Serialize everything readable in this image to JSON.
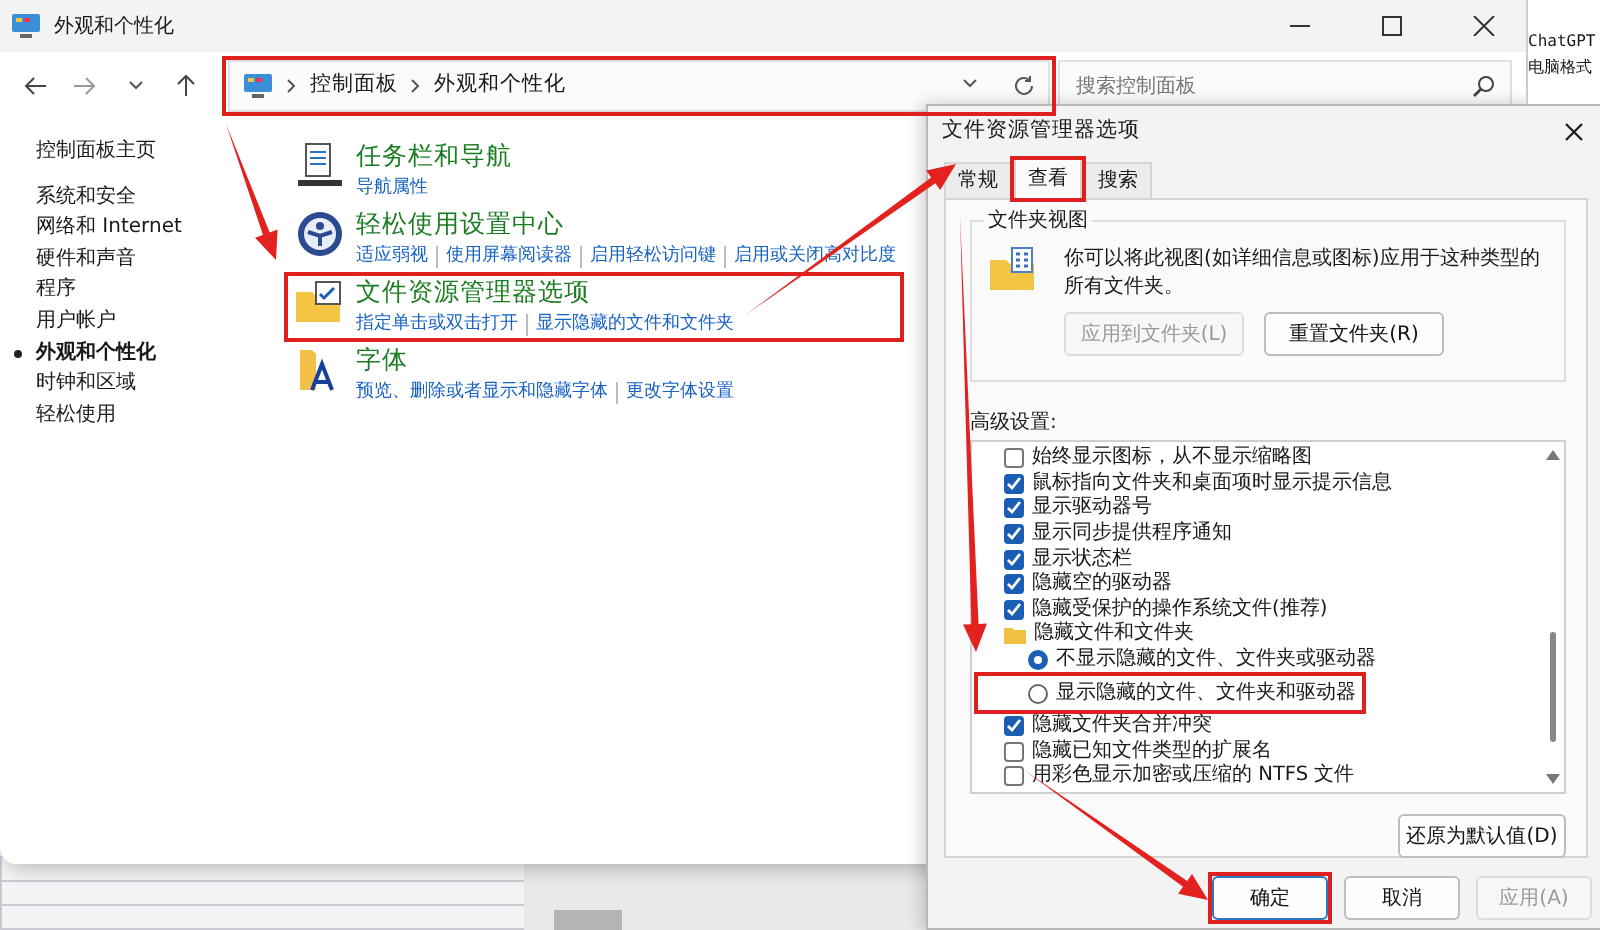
{
  "background_window": {
    "lines": [
      "ChatGPT",
      "电脑格式"
    ]
  },
  "main_window": {
    "title": "外观和个性化",
    "breadcrumb": [
      "控制面板",
      "外观和个性化"
    ],
    "search": {
      "placeholder": "搜索控制面板"
    },
    "sidebar": {
      "items": [
        {
          "label": "控制面板主页",
          "selected": false
        },
        {
          "label": "系统和安全",
          "selected": false
        },
        {
          "label": "网络和 Internet",
          "selected": false
        },
        {
          "label": "硬件和声音",
          "selected": false
        },
        {
          "label": "程序",
          "selected": false
        },
        {
          "label": "用户帐户",
          "selected": false
        },
        {
          "label": "外观和个性化",
          "selected": true
        },
        {
          "label": "时钟和区域",
          "selected": false
        },
        {
          "label": "轻松使用",
          "selected": false
        }
      ]
    },
    "categories": [
      {
        "title": "任务栏和导航",
        "links": [
          "导航属性"
        ]
      },
      {
        "title": "轻松使用设置中心",
        "links": [
          "适应弱视",
          "使用屏幕阅读器",
          "启用轻松访问键",
          "启用或关闭高对比度"
        ]
      },
      {
        "title": "文件资源管理器选项",
        "links": [
          "指定单击或双击打开",
          "显示隐藏的文件和文件夹"
        ]
      },
      {
        "title": "字体",
        "links": [
          "预览、删除或者显示和隐藏字体",
          "更改字体设置"
        ]
      }
    ]
  },
  "dialog": {
    "title": "文件资源管理器选项",
    "tabs": [
      {
        "label": "常规",
        "selected": false
      },
      {
        "label": "查看",
        "selected": true
      },
      {
        "label": "搜索",
        "selected": false
      }
    ],
    "group": {
      "title": "文件夹视图",
      "text": "你可以将此视图(如详细信息或图标)应用于这种类型的所有文件夹。",
      "buttons": [
        {
          "label": "应用到文件夹(L)",
          "disabled": true
        },
        {
          "label": "重置文件夹(R)",
          "disabled": false
        }
      ]
    },
    "advanced_label": "高级设置:",
    "settings": [
      {
        "kind": "checkbox",
        "label": "始终显示图标，从不显示缩略图",
        "checked": false
      },
      {
        "kind": "checkbox",
        "label": "鼠标指向文件夹和桌面项时显示提示信息",
        "checked": true
      },
      {
        "kind": "checkbox",
        "label": "显示驱动器号",
        "checked": true
      },
      {
        "kind": "checkbox",
        "label": "显示同步提供程序通知",
        "checked": true
      },
      {
        "kind": "checkbox",
        "label": "显示状态栏",
        "checked": true
      },
      {
        "kind": "checkbox",
        "label": "隐藏空的驱动器",
        "checked": true
      },
      {
        "kind": "checkbox",
        "label": "隐藏受保护的操作系统文件(推荐)",
        "checked": true
      },
      {
        "kind": "folder",
        "label": "隐藏文件和文件夹"
      },
      {
        "kind": "radio",
        "label": "不显示隐藏的文件、文件夹或驱动器",
        "selected": true
      },
      {
        "kind": "radio",
        "label": "显示隐藏的文件、文件夹和驱动器",
        "selected": false
      },
      {
        "kind": "checkbox",
        "label": "隐藏文件夹合并冲突",
        "checked": true
      },
      {
        "kind": "checkbox",
        "label": "隐藏已知文件类型的扩展名",
        "checked": false
      },
      {
        "kind": "checkbox",
        "label": "用彩色显示加密或压缩的 NTFS 文件",
        "checked": false
      }
    ],
    "restore_button": "还原为默认值(D)",
    "buttons": [
      {
        "label": "确定",
        "disabled": false
      },
      {
        "label": "取消",
        "disabled": false
      },
      {
        "label": "应用(A)",
        "disabled": true
      }
    ]
  }
}
